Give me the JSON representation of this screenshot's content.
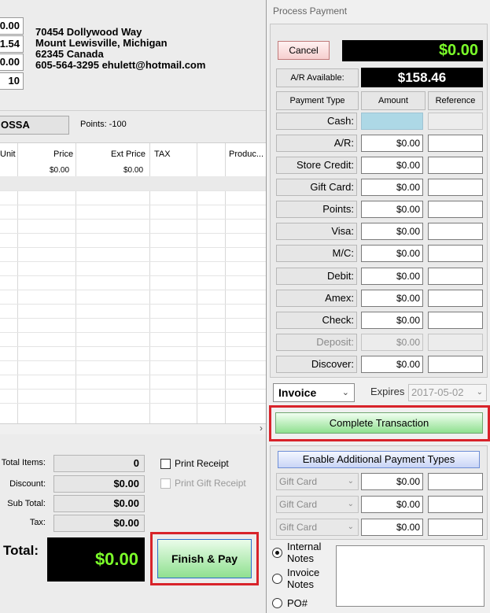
{
  "left": {
    "totals_top": [
      "0.00",
      "1.54",
      "0.00",
      "10"
    ],
    "address": {
      "line1": "70454 Dollywood Way",
      "line2": "Mount Lewisville, Michigan",
      "line3": "62345 Canada",
      "line4": "605-564-3295 ehulett@hotmail.com"
    },
    "customer_id": "OSSA",
    "points": "Points: -100",
    "grid": {
      "headers": [
        "Unit",
        "Price",
        "Ext Price",
        "TAX",
        "Produc..."
      ],
      "row1": {
        "price": "$0.00",
        "ext_price": "$0.00"
      }
    },
    "scroll_arrow": "›",
    "summary": {
      "total_items_label": "Total Items:",
      "total_items_value": "0",
      "discount_label": "Discount:",
      "discount_value": "$0.00",
      "subtotal_label": "Sub Total:",
      "subtotal_value": "$0.00",
      "tax_label": "Tax:",
      "tax_value": "$0.00"
    },
    "print_receipt": "Print Receipt",
    "print_gift_receipt": "Print Gift Receipt",
    "total_label": "Total:",
    "total_value": "$0.00",
    "finish_pay": "Finish & Pay"
  },
  "dialog": {
    "title": "Process Payment",
    "cancel": "Cancel",
    "amount_due": "$0.00",
    "ar_available_label": "A/R  Available:",
    "ar_available_value": "$158.46",
    "col_payment_type": "Payment Type",
    "col_amount": "Amount",
    "col_reference": "Reference",
    "payments": [
      {
        "label": "Cash:",
        "amount": ""
      },
      {
        "label": "A/R:",
        "amount": "$0.00"
      },
      {
        "label": "Store Credit:",
        "amount": "$0.00"
      },
      {
        "label": "Gift Card:",
        "amount": "$0.00"
      },
      {
        "label": "Points:",
        "amount": "$0.00"
      },
      {
        "label": "Visa:",
        "amount": "$0.00"
      },
      {
        "label": "M/C:",
        "amount": "$0.00"
      },
      {
        "label": "Debit:",
        "amount": "$0.00"
      },
      {
        "label": "Amex:",
        "amount": "$0.00"
      },
      {
        "label": "Check:",
        "amount": "$0.00"
      },
      {
        "label": "Deposit:",
        "amount": "$0.00"
      },
      {
        "label": "Discover:",
        "amount": "$0.00"
      }
    ],
    "invoice_select": "Invoice",
    "expires_label": "Expires",
    "expires_value": "2017-05-02",
    "complete_transaction": "Complete Transaction",
    "enable_additional": "Enable Additional Payment Types",
    "additional": [
      {
        "type": "Gift Card",
        "amount": "$0.00"
      },
      {
        "type": "Gift Card",
        "amount": "$0.00"
      },
      {
        "type": "Gift Card",
        "amount": "$0.00"
      }
    ],
    "notes_options": {
      "internal": "Internal Notes",
      "invoice": "Invoice Notes",
      "po": "PO#"
    }
  }
}
